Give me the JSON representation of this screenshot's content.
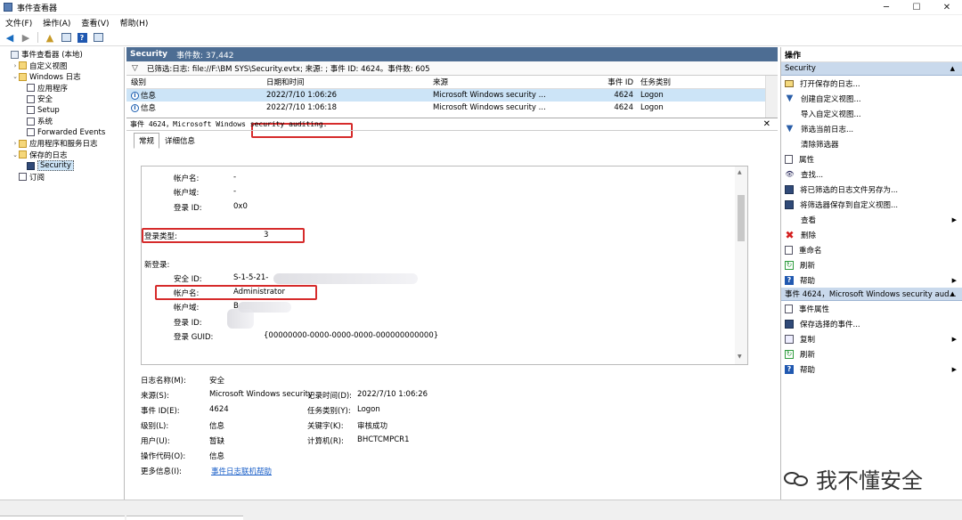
{
  "window": {
    "title": "事件查看器",
    "minimize": "─",
    "maximize": "☐",
    "close": "✕"
  },
  "menu": [
    "文件(F)",
    "操作(A)",
    "查看(V)",
    "帮助(H)"
  ],
  "tree": [
    {
      "label": "事件查看器 (本地)",
      "indent": 0,
      "arrow": "",
      "icon": "computer"
    },
    {
      "label": "自定义视图",
      "indent": 1,
      "arrow": "›",
      "icon": "folder"
    },
    {
      "label": "Windows 日志",
      "indent": 1,
      "arrow": "⌄",
      "icon": "folder"
    },
    {
      "label": "应用程序",
      "indent": 2,
      "arrow": "",
      "icon": "log"
    },
    {
      "label": "安全",
      "indent": 2,
      "arrow": "",
      "icon": "log"
    },
    {
      "label": "Setup",
      "indent": 2,
      "arrow": "",
      "icon": "log"
    },
    {
      "label": "系统",
      "indent": 2,
      "arrow": "",
      "icon": "log"
    },
    {
      "label": "Forwarded Events",
      "indent": 2,
      "arrow": "",
      "icon": "log"
    },
    {
      "label": "应用程序和服务日志",
      "indent": 1,
      "arrow": "›",
      "icon": "folder"
    },
    {
      "label": "保存的日志",
      "indent": 1,
      "arrow": "⌄",
      "icon": "folder"
    },
    {
      "label": "Security",
      "indent": 2,
      "arrow": "",
      "icon": "save",
      "selected": true
    },
    {
      "label": "订阅",
      "indent": 1,
      "arrow": "",
      "icon": "log"
    }
  ],
  "center": {
    "title": "Security",
    "count": "事件数: 37,442",
    "filter": "已筛选:日志: file://F:\\BM SYS\\Security.evtx; 来源: ; 事件 ID: 4624。事件数: 605",
    "columns": [
      "级别",
      "日期和时间",
      "来源",
      "事件 ID",
      "任务类别"
    ],
    "rows": [
      {
        "level": "信息",
        "datetime": "2022/7/10 1:06:26",
        "source": "Microsoft Windows security ...",
        "id": "4624",
        "task": "Logon"
      },
      {
        "level": "信息",
        "datetime": "2022/7/10 1:06:18",
        "source": "Microsoft Windows security ...",
        "id": "4624",
        "task": "Logon"
      }
    ],
    "detail_title": "事件 4624，Microsoft Windows security auditing.",
    "close": "✕",
    "tabs": [
      "常规",
      "详细信息"
    ]
  },
  "description": {
    "acct_name_label": "帐户名:",
    "acct_name_value": "-",
    "acct_domain_label": "帐户域:",
    "acct_domain_value": "-",
    "logon_id_label": "登录 ID:",
    "logon_id_value": "0x0",
    "logon_type_label": "登录类型:",
    "logon_type_value": "3",
    "new_logon": "新登录:",
    "sid_label": "安全 ID:",
    "sid_value": "S-1-5-21-",
    "new_acct_label": "帐户名:",
    "new_acct_value": "Administrator",
    "new_domain_label": "帐户域:",
    "new_domain_value": "B",
    "new_logon_id_label": "登录 ID:",
    "guid_label": "登录 GUID:",
    "guid_value": "{00000000-0000-0000-0000-000000000000}"
  },
  "props": {
    "logname_label": "日志名称(M):",
    "logname_value": "安全",
    "source_label": "来源(S):",
    "source_value": "Microsoft Windows security",
    "logged_label": "记录时间(D):",
    "logged_value": "2022/7/10 1:06:26",
    "eventid_label": "事件 ID(E):",
    "eventid_value": "4624",
    "task_label": "任务类别(Y):",
    "task_value": "Logon",
    "level_label": "级别(L):",
    "level_value": "信息",
    "keywords_label": "关键字(K):",
    "keywords_value": "审核成功",
    "user_label": "用户(U):",
    "user_value": "暂缺",
    "computer_label": "计算机(R):",
    "computer_value": "BHCTCMPCR1",
    "opcode_label": "操作代码(O):",
    "opcode_value": "信息",
    "more_label": "更多信息(I):",
    "more_value": "事件日志联机帮助"
  },
  "actions": {
    "header": "操作",
    "section1": "Security",
    "items1": [
      {
        "label": "打开保存的日志...",
        "icon": "open"
      },
      {
        "label": "创建自定义视图...",
        "icon": "filter"
      },
      {
        "label": "导入自定义视图...",
        "icon": "blank"
      },
      {
        "label": "筛选当前日志...",
        "icon": "filter"
      },
      {
        "label": "清除筛选器",
        "icon": "blank"
      },
      {
        "label": "属性",
        "icon": "doc"
      },
      {
        "label": "查找...",
        "icon": "find"
      },
      {
        "label": "将已筛选的日志文件另存为...",
        "icon": "save"
      },
      {
        "label": "将筛选器保存到自定义视图...",
        "icon": "save"
      },
      {
        "label": "查看",
        "icon": "blank",
        "more": true
      },
      {
        "label": "删除",
        "icon": "del"
      },
      {
        "label": "重命名",
        "icon": "doc"
      },
      {
        "label": "刷新",
        "icon": "refresh"
      },
      {
        "label": "帮助",
        "icon": "help",
        "more": true
      }
    ],
    "section2": "事件 4624，Microsoft Windows security aud...",
    "items2": [
      {
        "label": "事件属性",
        "icon": "doc"
      },
      {
        "label": "保存选择的事件...",
        "icon": "save"
      },
      {
        "label": "复制",
        "icon": "copy",
        "more": true
      },
      {
        "label": "刷新",
        "icon": "refresh"
      },
      {
        "label": "帮助",
        "icon": "help",
        "more": true
      }
    ]
  },
  "watermark": "我不懂安全"
}
